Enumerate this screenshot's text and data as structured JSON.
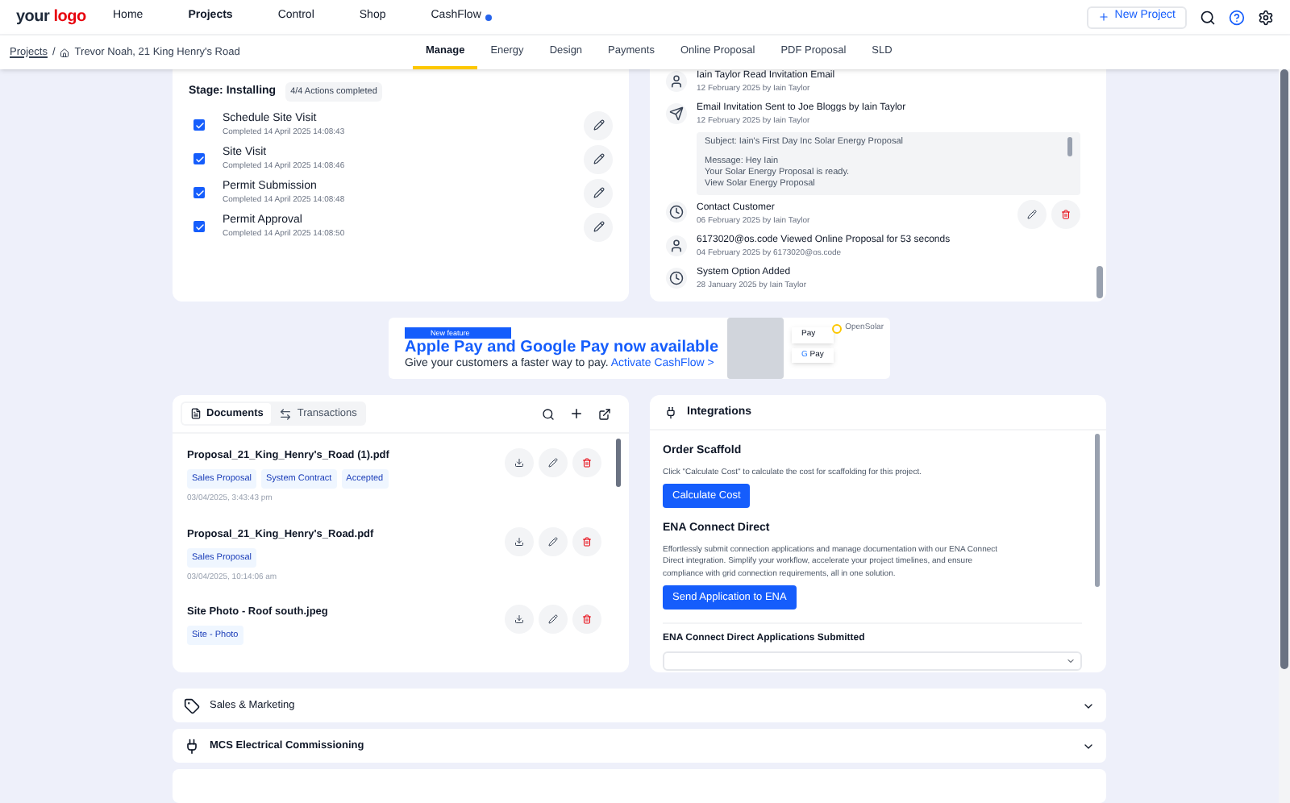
{
  "topnav": {
    "logo": "your logo",
    "items": [
      {
        "label": "Home",
        "selected": false
      },
      {
        "label": "Projects",
        "selected": true
      },
      {
        "label": "Control",
        "selected": false
      },
      {
        "label": "Shop",
        "selected": false
      },
      {
        "label": "CashFlow",
        "selected": false,
        "color": "#2563eb"
      }
    ],
    "new_project": "New Project"
  },
  "breadcrumb": {
    "root": "Projects",
    "separator": "/",
    "current": "Trevor Noah, 21 King Henry's Road"
  },
  "tabs": [
    {
      "label": "Manage",
      "selected": true
    },
    {
      "label": "Energy",
      "selected": false
    },
    {
      "label": "Design",
      "selected": false
    },
    {
      "label": "Payments",
      "selected": false
    },
    {
      "label": "Online Proposal",
      "selected": false
    },
    {
      "label": "PDF Proposal",
      "selected": false
    },
    {
      "label": "SLD",
      "selected": false
    }
  ],
  "stage": {
    "title": "Stage: Installing",
    "badge": "4/4 Actions completed",
    "actions": [
      {
        "label": "Schedule Site Visit",
        "checked": true,
        "detail": "Completed 14 April 2025 14:08:43"
      },
      {
        "label": "Site Visit",
        "checked": true,
        "detail": "Completed 14 April 2025 14:08:46"
      },
      {
        "label": "Permit Submission",
        "checked": true,
        "detail": "Completed 14 April 2025 14:08:48"
      },
      {
        "label": "Permit Approval",
        "checked": true,
        "detail": "Completed 14 April 2025 14:08:50"
      }
    ]
  },
  "activity": [
    {
      "kind": "person",
      "title": "Iain Taylor Read Invitation Email",
      "meta": "12 February 2025 by Iain Taylor"
    },
    {
      "kind": "email",
      "title": "Email Invitation Sent to Joe Bloggs by Iain Taylor",
      "meta": "12 February 2025 by Iain Taylor",
      "message": {
        "subject": "Subject: Iain's First Day Inc Solar Energy Proposal",
        "body": [
          "Message: Hey Iain",
          "Your Solar Energy Proposal is ready.",
          "View Solar Energy Proposal"
        ]
      }
    },
    {
      "kind": "task",
      "title": "Contact Customer",
      "meta": "06 February 2025 by Iain Taylor",
      "editable": true
    },
    {
      "kind": "person",
      "title": "6173020@os.code Viewed Online Proposal for 53 seconds",
      "meta": "04 February 2025 by 6173020@os.code"
    },
    {
      "kind": "task",
      "title": "System Option Added",
      "meta": "28 January 2025 by Iain Taylor"
    }
  ],
  "banner": {
    "tag": "New feature",
    "headline": "Apple Pay and Google Pay now available",
    "text": "Give your customers a faster way to pay.",
    "link": "Activate CashFlow >",
    "apple_pay": "Pay",
    "google_mark": "G",
    "google_pay": "Pay",
    "brand": "OpenSolar"
  },
  "documents": {
    "tabs": [
      {
        "label": "Documents",
        "selected": true
      },
      {
        "label": "Transactions",
        "selected": false
      }
    ],
    "items": [
      {
        "name": "Proposal_21_King_Henry's_Road (1).pdf",
        "tags": [
          "Sales Proposal",
          "System Contract",
          "Accepted"
        ],
        "date": "03/04/2025, 3:43:43 pm"
      },
      {
        "name": "Proposal_21_King_Henry's_Road.pdf",
        "tags": [
          "Sales Proposal"
        ],
        "date": "03/04/2025, 10:14:06 am"
      },
      {
        "name": "Site Photo - Roof south.jpeg",
        "tags": [
          "Site - Photo"
        ]
      }
    ]
  },
  "integrations": {
    "title": "Integrations",
    "sections": [
      {
        "title": "Order Scaffold",
        "text": "Click \"Calculate Cost\" to calculate the cost for scaffolding for this project.",
        "button": "Calculate Cost"
      },
      {
        "title": "ENA Connect Direct",
        "text": "Effortlessly submit connection applications and manage documentation with our ENA Connect Direct integration. Simplify your workflow, accelerate your project timelines, and ensure compliance with grid connection requirements, all in one solution.",
        "button": "Send Application to ENA"
      }
    ],
    "submitted_title": "ENA Connect Direct Applications Submitted"
  },
  "accordions": [
    {
      "label": "Sales & Marketing",
      "kind": "tag",
      "expanded": false
    },
    {
      "label": "MCS Electrical Commissioning",
      "kind": "plug",
      "expanded": false
    }
  ]
}
